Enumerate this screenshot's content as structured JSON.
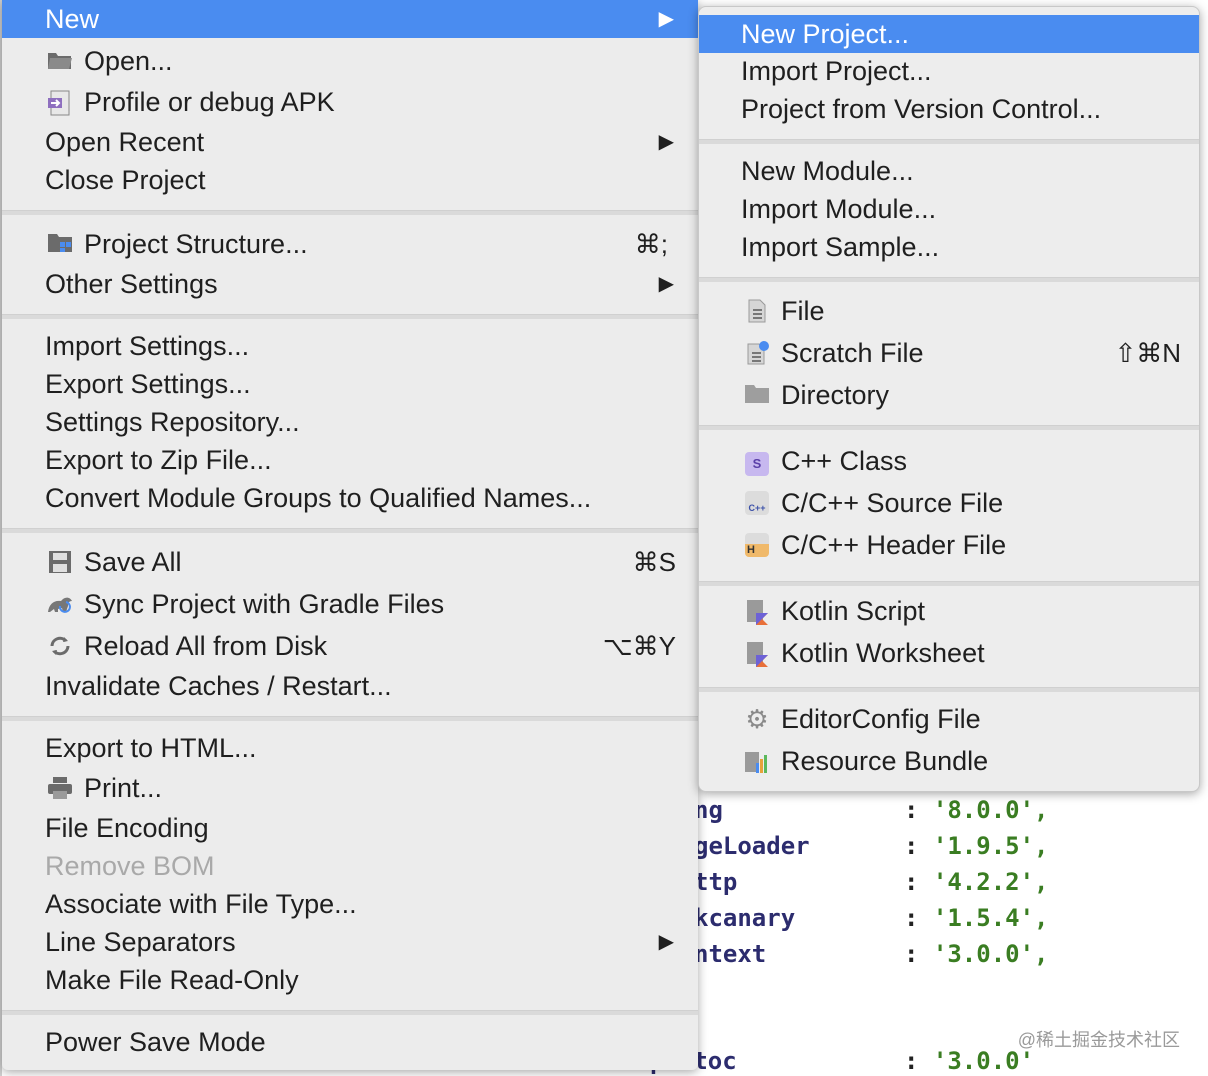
{
  "main_menu": {
    "items": [
      {
        "label": "New",
        "arrow": "▶",
        "selected": true
      },
      {
        "label": "Open...",
        "icon": "folder-icon"
      },
      {
        "label": "Profile or debug APK",
        "icon": "apk-icon"
      },
      {
        "label": "Open Recent",
        "arrow": "▶"
      },
      {
        "label": "Close Project"
      },
      {
        "label": "Project Structure...",
        "icon": "project-structure-icon",
        "shortcut": "⌘;"
      },
      {
        "label": "Other Settings",
        "arrow": "▶"
      },
      {
        "label": "Import Settings..."
      },
      {
        "label": "Export Settings..."
      },
      {
        "label": "Settings Repository..."
      },
      {
        "label": "Export to Zip File..."
      },
      {
        "label": "Convert Module Groups to Qualified Names..."
      },
      {
        "label": "Save All",
        "icon": "save-icon",
        "shortcut": "⌘S"
      },
      {
        "label": "Sync Project with Gradle Files",
        "icon": "gradle-sync-icon"
      },
      {
        "label": "Reload All from Disk",
        "icon": "reload-icon",
        "shortcut": "⌥⌘Y"
      },
      {
        "label": "Invalidate Caches / Restart..."
      },
      {
        "label": "Export to HTML..."
      },
      {
        "label": "Print...",
        "icon": "print-icon"
      },
      {
        "label": "File Encoding"
      },
      {
        "label": "Remove BOM",
        "disabled": true
      },
      {
        "label": "Associate with File Type..."
      },
      {
        "label": "Line Separators",
        "arrow": "▶"
      },
      {
        "label": "Make File Read-Only"
      },
      {
        "label": "Power Save Mode"
      }
    ]
  },
  "submenu_new": {
    "items": [
      {
        "label": "New Project...",
        "selected": true
      },
      {
        "label": "Import Project..."
      },
      {
        "label": "Project from Version Control..."
      },
      {
        "label": "New Module..."
      },
      {
        "label": "Import Module..."
      },
      {
        "label": "Import Sample..."
      },
      {
        "label": "File",
        "icon": "file-icon"
      },
      {
        "label": "Scratch File",
        "icon": "scratch-file-icon",
        "shortcut": "⇧⌘N"
      },
      {
        "label": "Directory",
        "icon": "directory-icon"
      },
      {
        "label": "C++ Class",
        "icon": "cpp-class-icon",
        "badge": "S"
      },
      {
        "label": "C/C++ Source File",
        "icon": "cpp-source-icon",
        "badge": "C++"
      },
      {
        "label": "C/C++ Header File",
        "icon": "cpp-header-icon",
        "badge": "H"
      },
      {
        "label": "Kotlin Script",
        "icon": "kotlin-script-icon"
      },
      {
        "label": "Kotlin Worksheet",
        "icon": "kotlin-worksheet-icon"
      },
      {
        "label": "EditorConfig File",
        "icon": "gear-icon"
      },
      {
        "label": "Resource Bundle",
        "icon": "resource-bundle-icon"
      }
    ]
  },
  "editor": {
    "lines": [
      {
        "key": "ng",
        "colon": ":",
        "value": "'8.0.0',"
      },
      {
        "key": "geLoader",
        "colon": ":",
        "value": "'1.9.5',"
      },
      {
        "key": "ttp",
        "colon": ":",
        "value": "'4.2.2',"
      },
      {
        "key": "kcanary",
        "colon": ":",
        "value": "'1.5.4',"
      },
      {
        "key": "ntext",
        "colon": ":",
        "value": "'3.0.0',"
      },
      {
        "key": "protoc",
        "colon": ":",
        "value": "'3.0.0'"
      }
    ],
    "watermark": "@稀土掘金技术社区"
  },
  "colors": {
    "selection": "#4a8cf0",
    "menu_bg": "#ececec",
    "string": "#3a7d22",
    "key": "#2c2c6e"
  }
}
